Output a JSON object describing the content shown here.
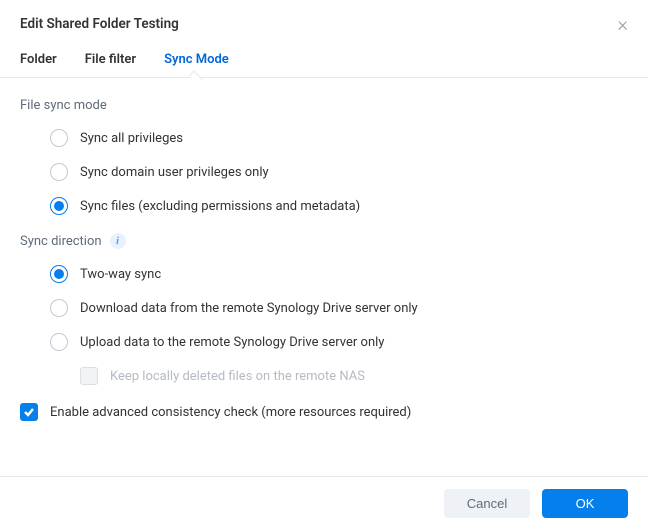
{
  "header": {
    "title": "Edit Shared Folder Testing"
  },
  "tabs": [
    {
      "label": "Folder",
      "active": false
    },
    {
      "label": "File filter",
      "active": false
    },
    {
      "label": "Sync Mode",
      "active": true
    }
  ],
  "sections": {
    "fileSyncMode": {
      "label": "File sync mode",
      "options": [
        {
          "label": "Sync all privileges",
          "checked": false
        },
        {
          "label": "Sync domain user privileges only",
          "checked": false
        },
        {
          "label": "Sync files (excluding permissions and metadata)",
          "checked": true
        }
      ]
    },
    "syncDirection": {
      "label": "Sync direction",
      "options": [
        {
          "label": "Two-way sync",
          "checked": true
        },
        {
          "label": "Download data from the remote Synology Drive server only",
          "checked": false
        },
        {
          "label": "Upload data to the remote Synology Drive server only",
          "checked": false
        }
      ],
      "subOption": {
        "label": "Keep locally deleted files on the remote NAS",
        "checked": false,
        "disabled": true
      }
    },
    "consistency": {
      "label": "Enable advanced consistency check (more resources required)",
      "checked": true
    }
  },
  "footer": {
    "cancel": "Cancel",
    "ok": "OK"
  }
}
